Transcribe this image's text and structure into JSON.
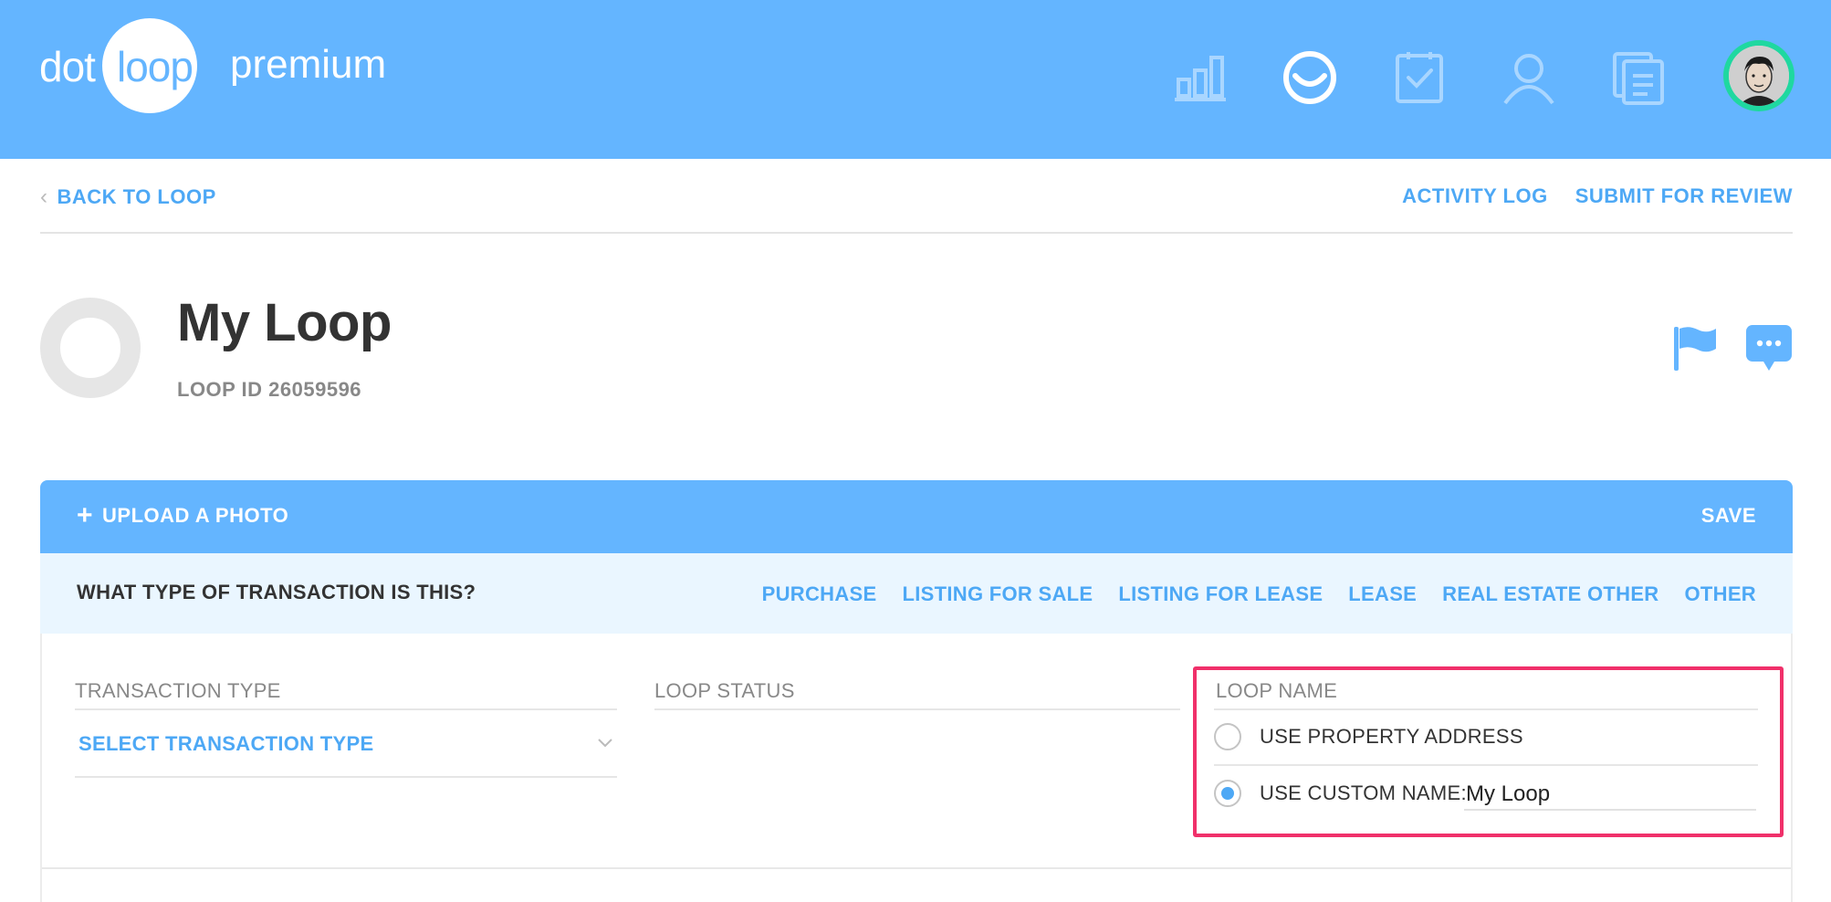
{
  "header": {
    "logo_part1": "dot",
    "logo_part2": "loop",
    "logo_suffix": "premium",
    "nav_icons": [
      "reports-icon",
      "loop-icon",
      "tasks-icon",
      "people-icon",
      "documents-icon"
    ],
    "brand_color": "#64b5ff"
  },
  "subnav": {
    "back_label": "BACK TO LOOP",
    "activity_log": "ACTIVITY LOG",
    "submit_review": "SUBMIT FOR REVIEW"
  },
  "loop": {
    "title": "My Loop",
    "id_label": "LOOP ID 26059596"
  },
  "panel": {
    "upload_label": "UPLOAD A PHOTO",
    "save_label": "SAVE",
    "question": "WHAT TYPE OF TRANSACTION IS THIS?",
    "types": [
      "PURCHASE",
      "LISTING FOR SALE",
      "LISTING FOR LEASE",
      "LEASE",
      "REAL ESTATE OTHER",
      "OTHER"
    ]
  },
  "fields": {
    "transaction_type_label": "TRANSACTION TYPE",
    "transaction_type_value": "SELECT TRANSACTION TYPE",
    "loop_status_label": "LOOP STATUS",
    "loop_name_label": "LOOP NAME",
    "option_address": "USE PROPERTY ADDRESS",
    "option_custom": "USE CUSTOM NAME:",
    "custom_name_value": "My Loop",
    "selected_option": "custom"
  },
  "colors": {
    "accent": "#4da8f5",
    "highlight": "#f0306a",
    "avatar_ring": "#1fd8a0"
  }
}
